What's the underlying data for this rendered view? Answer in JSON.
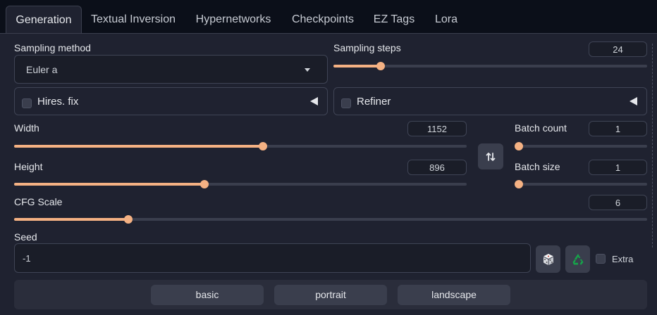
{
  "tabs": [
    {
      "label": "Generation",
      "active": true
    },
    {
      "label": "Textual Inversion"
    },
    {
      "label": "Hypernetworks"
    },
    {
      "label": "Checkpoints"
    },
    {
      "label": "EZ Tags"
    },
    {
      "label": "Lora"
    }
  ],
  "sampling_method": {
    "label": "Sampling method",
    "value": "Euler a"
  },
  "sampling_steps": {
    "label": "Sampling steps",
    "value": "24",
    "level": 0.15
  },
  "hires": {
    "label": "Hires. fix",
    "checked": false
  },
  "refiner": {
    "label": "Refiner",
    "checked": false
  },
  "width": {
    "label": "Width",
    "value": "1152",
    "level": 0.55
  },
  "height": {
    "label": "Height",
    "value": "896",
    "level": 0.42
  },
  "batch_count": {
    "label": "Batch count",
    "value": "1",
    "level": 0.0
  },
  "batch_size": {
    "label": "Batch size",
    "value": "1",
    "level": 0.0
  },
  "cfg": {
    "label": "CFG Scale",
    "value": "6",
    "level": 0.18
  },
  "seed": {
    "label": "Seed",
    "value": "-1",
    "extra_label": "Extra"
  },
  "presets": [
    "basic",
    "portrait",
    "landscape"
  ],
  "colors": {
    "accent": "#f4b183",
    "panel": "#1f2230",
    "background": "#0b0f19"
  },
  "icons": {
    "swap": "swap-arrows-icon",
    "dice": "dice-icon",
    "recycle": "recycle-icon",
    "collapse": "triangle-left-icon"
  }
}
